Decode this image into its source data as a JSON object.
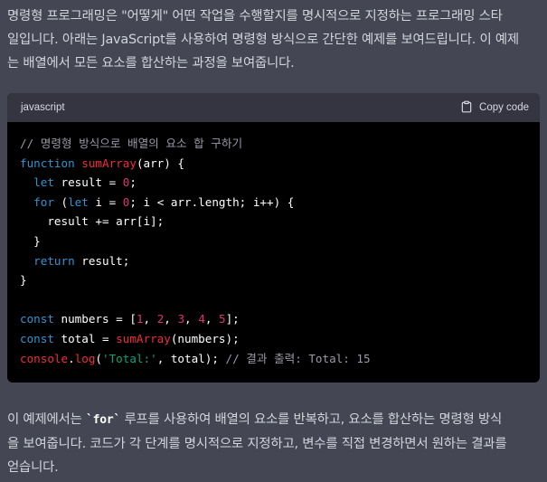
{
  "intro": {
    "line1": "명령형 프로그래밍은 \"어떻게\" 어떤 작업을 수행할지를 명시적으로 지정하는 프로그래밍 스타",
    "line2": "일입니다. 아래는 JavaScript를 사용하여 명령형 방식으로 간단한 예제를 보여드립니다. 이 예제",
    "line3": "는 배열에서 모든 요소를 합산하는 과정을 보여줍니다."
  },
  "code_block": {
    "language": "javascript",
    "copy_label": "Copy code",
    "lines": [
      [
        {
          "t": "cm",
          "v": "// 명령형 방식으로 배열의 요소 합 구하기"
        }
      ],
      [
        {
          "t": "kw",
          "v": "function"
        },
        {
          "t": "p",
          "v": " "
        },
        {
          "t": "fn",
          "v": "sumArray"
        },
        {
          "t": "p",
          "v": "(arr) {"
        }
      ],
      [
        {
          "t": "p",
          "v": "  "
        },
        {
          "t": "kw",
          "v": "let"
        },
        {
          "t": "p",
          "v": " result = "
        },
        {
          "t": "num",
          "v": "0"
        },
        {
          "t": "p",
          "v": ";"
        }
      ],
      [
        {
          "t": "p",
          "v": "  "
        },
        {
          "t": "kw",
          "v": "for"
        },
        {
          "t": "p",
          "v": " ("
        },
        {
          "t": "kw",
          "v": "let"
        },
        {
          "t": "p",
          "v": " i = "
        },
        {
          "t": "num",
          "v": "0"
        },
        {
          "t": "p",
          "v": "; i < arr.length; i++) {"
        }
      ],
      [
        {
          "t": "p",
          "v": "    result += arr[i];"
        }
      ],
      [
        {
          "t": "p",
          "v": "  }"
        }
      ],
      [
        {
          "t": "p",
          "v": "  "
        },
        {
          "t": "kw",
          "v": "return"
        },
        {
          "t": "p",
          "v": " result;"
        }
      ],
      [
        {
          "t": "p",
          "v": "}"
        }
      ],
      [
        {
          "t": "p",
          "v": ""
        }
      ],
      [
        {
          "t": "kw",
          "v": "const"
        },
        {
          "t": "p",
          "v": " numbers = ["
        },
        {
          "t": "num",
          "v": "1"
        },
        {
          "t": "p",
          "v": ", "
        },
        {
          "t": "num",
          "v": "2"
        },
        {
          "t": "p",
          "v": ", "
        },
        {
          "t": "num",
          "v": "3"
        },
        {
          "t": "p",
          "v": ", "
        },
        {
          "t": "num",
          "v": "4"
        },
        {
          "t": "p",
          "v": ", "
        },
        {
          "t": "num",
          "v": "5"
        },
        {
          "t": "p",
          "v": "];"
        }
      ],
      [
        {
          "t": "kw",
          "v": "const"
        },
        {
          "t": "p",
          "v": " total = "
        },
        {
          "t": "fn",
          "v": "sumArray"
        },
        {
          "t": "p",
          "v": "(numbers);"
        }
      ],
      [
        {
          "t": "fn",
          "v": "console"
        },
        {
          "t": "p",
          "v": "."
        },
        {
          "t": "fn",
          "v": "log"
        },
        {
          "t": "p",
          "v": "("
        },
        {
          "t": "str",
          "v": "'Total:'"
        },
        {
          "t": "p",
          "v": ", total); "
        },
        {
          "t": "cm",
          "v": "// 결과 출력: Total: 15"
        }
      ]
    ]
  },
  "outro": {
    "line1_pre": "이 예제에서는 ",
    "line1_code": "`for`",
    "line1_post": " 루프를 사용하여 배열의 요소를 반복하고, 요소를 합산하는 명령형 방식",
    "line2": "을 보여줍니다. 코드가 각 단계를 명시적으로 지정하고, 변수를 직접 변경하면서 원하는 결과를",
    "line3": "얻습니다."
  },
  "icons": {
    "copy": "clipboard-icon"
  },
  "colors": {
    "background": "#444654",
    "code_bg": "#000000",
    "code_header_bg": "#343541",
    "keyword": "#2e95d3",
    "function": "#f22c3d",
    "number": "#df3079",
    "string": "#00a67d",
    "comment": "#9a9aa8"
  }
}
